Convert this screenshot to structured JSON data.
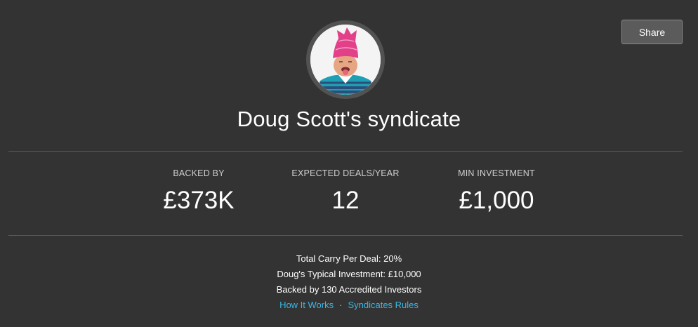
{
  "header": {
    "share_label": "Share",
    "title": "Doug Scott's syndicate"
  },
  "stats": [
    {
      "label": "BACKED BY",
      "value": "£373K"
    },
    {
      "label": "EXPECTED DEALS/YEAR",
      "value": "12"
    },
    {
      "label": "MIN INVESTMENT",
      "value": "£1,000"
    }
  ],
  "details": {
    "carry": "Total Carry Per Deal: 20%",
    "typical_investment": "Doug's Typical Investment: £10,000",
    "backers": "Backed by 130 Accredited Investors"
  },
  "links": {
    "how_it_works": "How It Works",
    "separator": "·",
    "syndicates_rules": "Syndicates Rules"
  },
  "colors": {
    "background": "#333333",
    "link": "#3ab7e6",
    "divider": "#5a5a5a"
  }
}
